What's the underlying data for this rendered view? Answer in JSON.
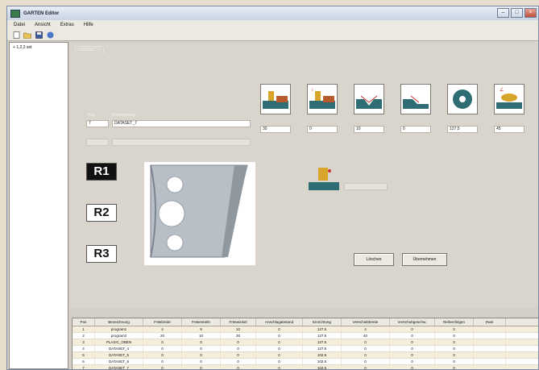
{
  "window": {
    "title": "GARTEN Editor",
    "controls": [
      "minimize-button",
      "maximize-button",
      "close-button"
    ]
  },
  "menu": [
    "Datei",
    "Ansicht",
    "Extras",
    "Hilfe"
  ],
  "tree": {
    "root_label": "1,2,3 set"
  },
  "profile_tab": "DATASET_1",
  "fields": {
    "pos_label": "Pos",
    "pos_value": "7",
    "name_label": "Bezeichnung",
    "name_value": "DATASET_7",
    "tool_values": [
      "30",
      "0",
      "10",
      "0",
      "127.5",
      "45"
    ]
  },
  "radius_labels": [
    "R1",
    "R2",
    "R3"
  ],
  "buttons": {
    "delete": "Löschen",
    "apply": "Übernehmen"
  },
  "grid": {
    "headers": [
      "Pos",
      "Bezeichnung",
      "Fräsbreite",
      "Fräsentiefe",
      "Fräswinkel",
      "Anschlagabstand",
      "Einrichtung",
      "Verschiebbreite",
      "Vorschubgeschw.",
      "Reihenfolgen",
      "Zwei"
    ],
    "rows": [
      [
        "1",
        "program1",
        "4",
        "9",
        "10",
        "0",
        "127.5",
        "4",
        "0",
        "0",
        ""
      ],
      [
        "2",
        "program2",
        "20",
        "10",
        "30",
        "0",
        "127.5",
        "40",
        "0",
        "0",
        ""
      ],
      [
        "3",
        "PLASIC_OBEN",
        "0",
        "0",
        "0",
        "0",
        "127.5",
        "0",
        "0",
        "0",
        ""
      ],
      [
        "4",
        "DATASET_4",
        "0",
        "0",
        "0",
        "0",
        "127.5",
        "0",
        "0",
        "0",
        ""
      ],
      [
        "5",
        "DATASET_5",
        "0",
        "0",
        "0",
        "0",
        "102.5",
        "0",
        "0",
        "0",
        ""
      ],
      [
        "6",
        "DATASET_6",
        "0",
        "0",
        "0",
        "0",
        "102.5",
        "0",
        "0",
        "0",
        ""
      ],
      [
        "7",
        "DATASET_7",
        "0",
        "0",
        "0",
        "0",
        "102.5",
        "0",
        "0",
        "0",
        ""
      ]
    ]
  },
  "colors": {
    "accent_teal": "#2e6d73",
    "tool_gold": "#d8a42a",
    "wood_brown": "#b85a2c"
  }
}
